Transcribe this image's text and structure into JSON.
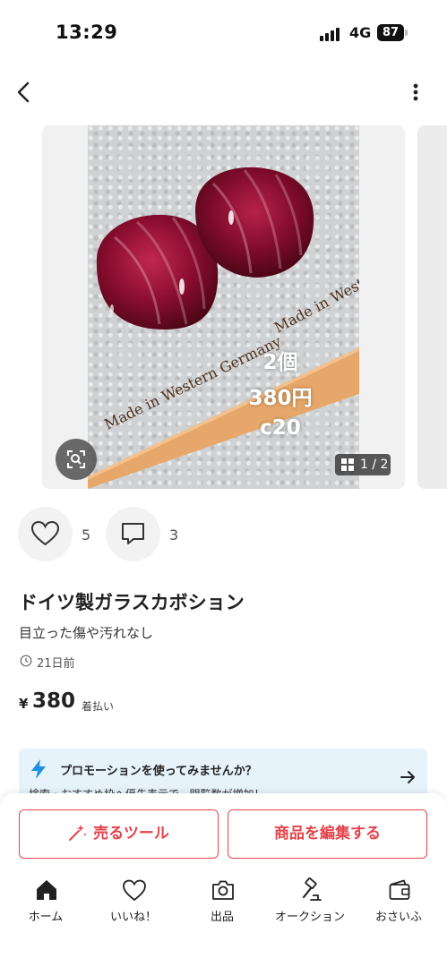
{
  "status_bar": {
    "time": "13:29",
    "network": "4G",
    "battery": "87"
  },
  "listing": {
    "title": "ドイツ製ガラスカボション",
    "description": "目立った傷や汚れなし",
    "posted": "21日前",
    "currency": "¥",
    "price": "380",
    "shipping": "着払い",
    "likes": "5",
    "comments": "3"
  },
  "photo": {
    "overlay": [
      "2個",
      "380円",
      "c20"
    ],
    "label_front": "Made in Western Germany",
    "label_back": "Made in Western Germ",
    "page_indicator": "1 / 2"
  },
  "promo": {
    "title": "プロモーションを使ってみませんか？",
    "desc": "検索・おすすめ枠へ優先表示で、閲覧数が増加！"
  },
  "actions": {
    "sell_tool": "売るツール",
    "edit_item": "商品を編集する"
  },
  "tabbar": [
    "ホーム",
    "いいね！",
    "出品",
    "オークション",
    "おさいふ"
  ],
  "colors": {
    "accent": "#e4434b",
    "promo_bg": "#e6f3fb",
    "promo_icon": "#1f8fe0"
  }
}
